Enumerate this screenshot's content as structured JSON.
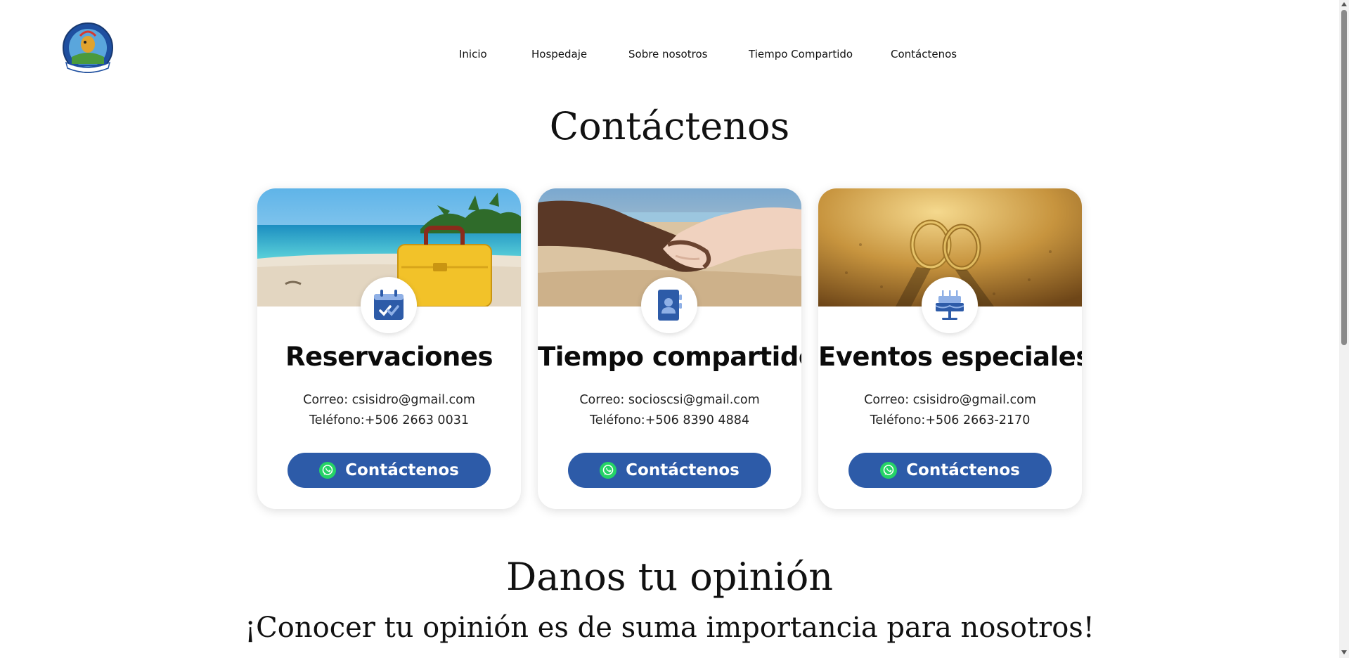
{
  "header": {
    "logo": {
      "name": "hotel-logo",
      "alt": "HOTEL Y CABINAS SAN ISIDRO"
    },
    "nav": [
      "Inicio",
      "Hospedaje",
      "Sobre nosotros",
      "Tiempo Compartido",
      "Contáctenos"
    ]
  },
  "contact_section": {
    "title": "Contáctenos",
    "cards": [
      {
        "image": "beach-suitcase-photo",
        "icon": "calendar-check-icon",
        "title": "Reservaciones",
        "email": "Correo: csisidro@gmail.com",
        "phone": "Teléfono:+506 2663 0031",
        "button_label": "Contáctenos",
        "button_icon": "whatsapp-icon"
      },
      {
        "image": "handshake-beach-photo",
        "icon": "contact-book-icon",
        "title": "Tiempo compartido",
        "email": "Correo: socioscsi@gmail.com",
        "phone": "Teléfono:+506 8390 4884",
        "button_label": "Contáctenos",
        "button_icon": "whatsapp-icon"
      },
      {
        "image": "rings-sand-photo",
        "icon": "cake-icon",
        "title": "Eventos especiales",
        "email": "Correo: csisidro@gmail.com",
        "phone": "Teléfono:+506 2663-2170",
        "button_label": "Contáctenos",
        "button_icon": "whatsapp-icon"
      }
    ]
  },
  "opinion_section": {
    "title": "Danos tu opinión",
    "subtitle": "¡Conocer tu opinión es de suma importancia para nosotros!"
  },
  "colors": {
    "button": "#2d5ba8",
    "icon_dark": "#2d5ba8",
    "icon_light": "#8fb0e6",
    "whatsapp": "#25d366"
  }
}
